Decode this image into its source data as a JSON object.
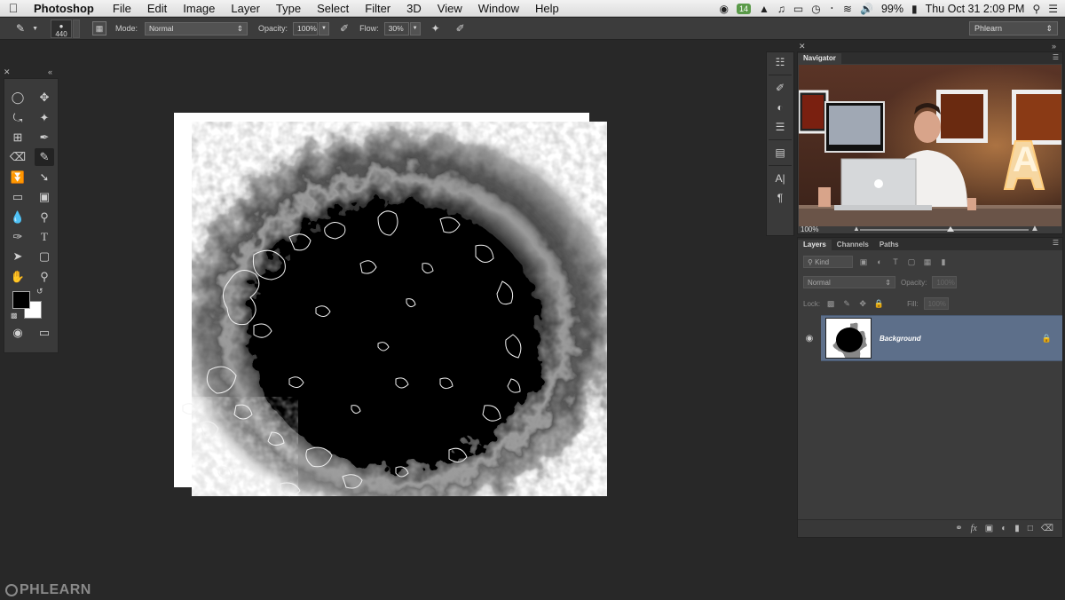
{
  "menubar": {
    "app_name": "Photoshop",
    "items": [
      "File",
      "Edit",
      "Image",
      "Layer",
      "Type",
      "Select",
      "Filter",
      "3D",
      "View",
      "Window",
      "Help"
    ],
    "status_badge": "14",
    "battery": "99%",
    "clock": "Thu Oct 31  2:09 PM"
  },
  "options": {
    "brush_size": "440",
    "mode_label": "Mode:",
    "mode_value": "Normal",
    "opacity_label": "Opacity:",
    "opacity_value": "100%",
    "flow_label": "Flow:",
    "flow_value": "30%",
    "workspace": "Phlearn"
  },
  "navigator": {
    "tab": "Navigator",
    "zoom": "100%"
  },
  "layers": {
    "tabs": [
      "Layers",
      "Channels",
      "Paths"
    ],
    "filter_kind": "Kind",
    "blend_mode": "Normal",
    "opacity_label": "Opacity:",
    "opacity_value": "100%",
    "lock_label": "Lock:",
    "fill_label": "Fill:",
    "fill_value": "100%",
    "layer_name": "Background"
  },
  "watermark": "PHLEARN",
  "video_letter": "A",
  "colors": {
    "foreground": "#000000",
    "background": "#ffffff",
    "selected_layer": "#5d6f8a"
  }
}
